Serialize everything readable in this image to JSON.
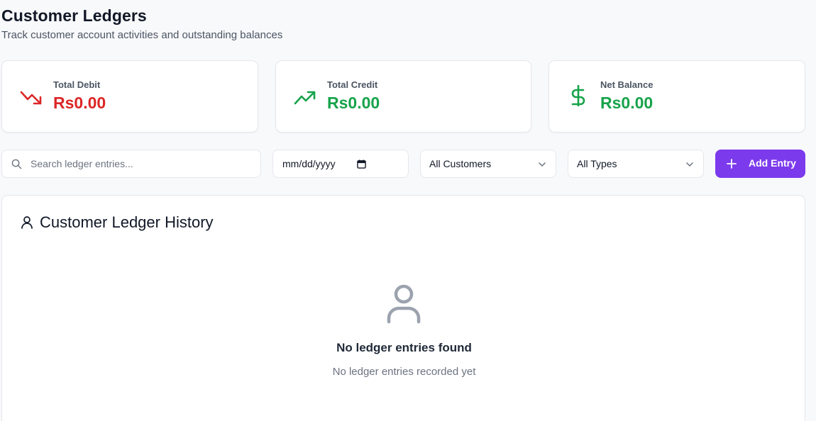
{
  "header": {
    "title": "Customer Ledgers",
    "subtitle": "Track customer account activities and outstanding balances"
  },
  "stats": [
    {
      "label": "Total Debit",
      "value": "Rs0.00",
      "color": "#dc2626",
      "icon": "trending-down-icon"
    },
    {
      "label": "Total Credit",
      "value": "Rs0.00",
      "color": "#16a34a",
      "icon": "trending-up-icon"
    },
    {
      "label": "Net Balance",
      "value": "Rs0.00",
      "color": "#16a34a",
      "icon": "dollar-icon"
    }
  ],
  "filters": {
    "search_placeholder": "Search ledger entries...",
    "date_placeholder": "mm/dd/yyyy",
    "customer_select": "All Customers",
    "type_select": "All Types"
  },
  "add_button": {
    "label": "Add Entry"
  },
  "history": {
    "title": "Customer Ledger History",
    "empty_title": "No ledger entries found",
    "empty_subtitle": "No ledger entries recorded yet"
  },
  "colors": {
    "accent": "#7c3aed",
    "debit": "#dc2626",
    "credit": "#16a34a"
  }
}
